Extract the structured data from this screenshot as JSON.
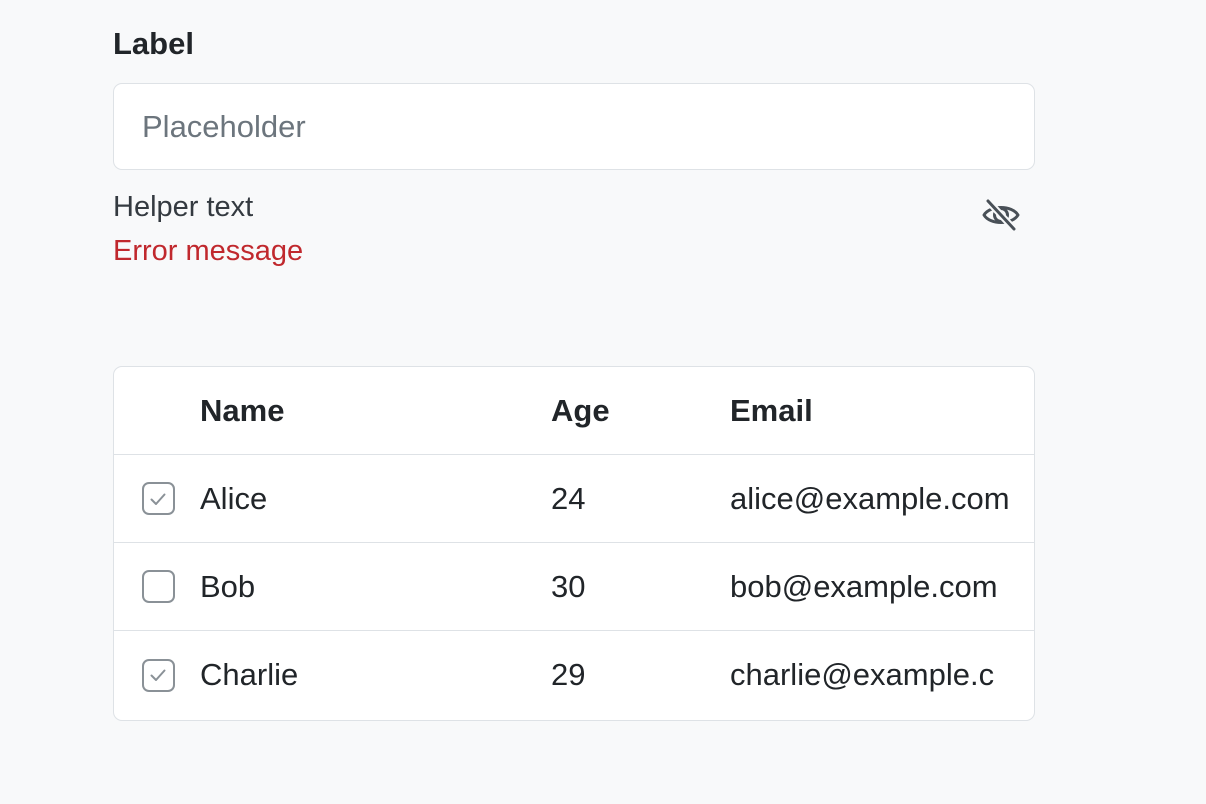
{
  "field": {
    "label": "Label",
    "placeholder": "Placeholder",
    "value": "",
    "helper_text": "Helper text",
    "error_message": "Error message",
    "toggle_icon": "eye-off-icon"
  },
  "table": {
    "columns": [
      "Name",
      "Age",
      "Email"
    ],
    "rows": [
      {
        "checked": true,
        "name": "Alice",
        "age": "24",
        "email": "alice@example.com"
      },
      {
        "checked": false,
        "name": "Bob",
        "age": "30",
        "email": "bob@example.com"
      },
      {
        "checked": true,
        "name": "Charlie",
        "age": "29",
        "email": "charlie@example.c"
      }
    ]
  },
  "colors": {
    "background": "#f8f9fa",
    "border": "#dee2e6",
    "text": "#212529",
    "placeholder": "#6c757d",
    "error": "#c0282d",
    "check_mark": "#8a9197"
  }
}
